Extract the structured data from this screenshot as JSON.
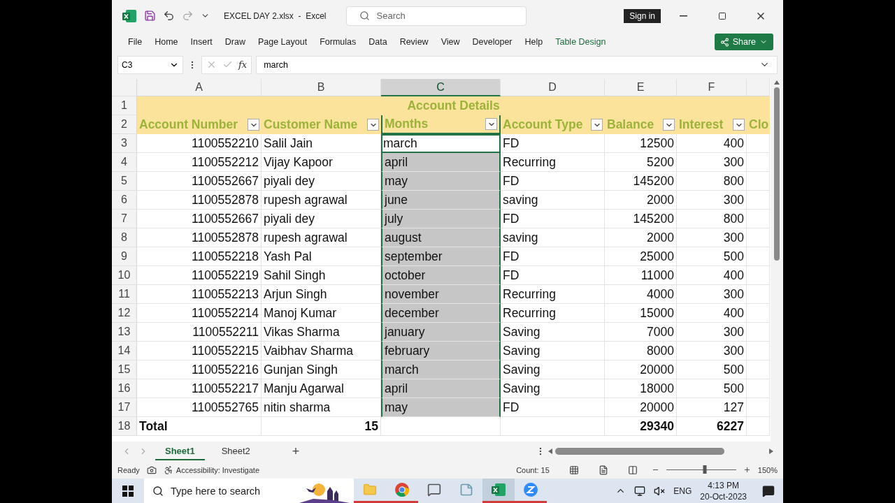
{
  "window": {
    "title": "EXCEL DAY 2.xlsx  -  Excel",
    "search_placeholder": "Search",
    "sign_in": "Sign in"
  },
  "ribbon_tabs": [
    {
      "label": "File",
      "kind": "normal"
    },
    {
      "label": "Home",
      "kind": "normal"
    },
    {
      "label": "Insert",
      "kind": "normal"
    },
    {
      "label": "Draw",
      "kind": "normal"
    },
    {
      "label": "Page Layout",
      "kind": "normal"
    },
    {
      "label": "Formulas",
      "kind": "normal"
    },
    {
      "label": "Data",
      "kind": "normal"
    },
    {
      "label": "Review",
      "kind": "normal"
    },
    {
      "label": "View",
      "kind": "normal"
    },
    {
      "label": "Developer",
      "kind": "normal"
    },
    {
      "label": "Help",
      "kind": "normal"
    },
    {
      "label": "Table Design",
      "kind": "contextual"
    }
  ],
  "share": "Share",
  "formula_bar": {
    "name_box": "C3",
    "fx": "fx",
    "value": "march"
  },
  "columns": [
    {
      "letter": "A",
      "selected": false
    },
    {
      "letter": "B",
      "selected": false
    },
    {
      "letter": "C",
      "selected": true
    },
    {
      "letter": "D",
      "selected": false
    },
    {
      "letter": "E",
      "selected": false
    },
    {
      "letter": "F",
      "selected": false
    }
  ],
  "title_row": {
    "number": "1",
    "text": "Account Details"
  },
  "header_row": {
    "number": "2",
    "cells": [
      "Account Number",
      "Customer Name",
      "Months",
      "Account Type",
      "Balance",
      "Interest",
      "Clo"
    ]
  },
  "rows": [
    {
      "number": "3",
      "active": true,
      "cells": [
        "1100552210",
        "Salil Jain",
        "march",
        "FD",
        "12500",
        "400"
      ]
    },
    {
      "number": "4",
      "active": false,
      "cells": [
        "1100552212",
        "Vijay Kapoor",
        "april",
        "Recurring",
        "5200",
        "300"
      ]
    },
    {
      "number": "5",
      "active": false,
      "cells": [
        "1100552667",
        "piyali dey",
        "may",
        "FD",
        "145200",
        "800"
      ]
    },
    {
      "number": "6",
      "active": false,
      "cells": [
        "1100552878",
        "rupesh agrawal",
        "june",
        "saving",
        "2000",
        "300"
      ]
    },
    {
      "number": "7",
      "active": false,
      "cells": [
        "1100552667",
        "piyali dey",
        "july",
        "FD",
        "145200",
        "800"
      ]
    },
    {
      "number": "8",
      "active": false,
      "cells": [
        "1100552878",
        "rupesh agrawal",
        "august",
        "saving",
        "2000",
        "300"
      ]
    },
    {
      "number": "9",
      "active": false,
      "cells": [
        "1100552218",
        "Yash Pal",
        "september",
        "FD",
        "25000",
        "500"
      ]
    },
    {
      "number": "10",
      "active": false,
      "cells": [
        "1100552219",
        "Sahil Singh",
        "october",
        "FD",
        "11000",
        "400"
      ]
    },
    {
      "number": "11",
      "active": false,
      "cells": [
        "1100552213",
        "Arjun Singh",
        "november",
        "Recurring",
        "4000",
        "300"
      ]
    },
    {
      "number": "12",
      "active": false,
      "cells": [
        "1100552214",
        "Manoj Kumar",
        "december",
        "Recurring",
        "15000",
        "400"
      ]
    },
    {
      "number": "13",
      "active": false,
      "cells": [
        "1100552211",
        "Vikas Sharma",
        "january",
        "Saving",
        "7000",
        "300"
      ]
    },
    {
      "number": "14",
      "active": false,
      "cells": [
        "1100552215",
        "Vaibhav Sharma",
        "february",
        "Saving",
        "8000",
        "300"
      ]
    },
    {
      "number": "15",
      "active": false,
      "cells": [
        "1100552216",
        "Gunjan Singh",
        "march",
        "Saving",
        "20000",
        "500"
      ]
    },
    {
      "number": "16",
      "active": false,
      "cells": [
        "1100552217",
        "Manju Agarwal",
        "april",
        "Saving",
        "18000",
        "500"
      ]
    },
    {
      "number": "17",
      "active": false,
      "cells": [
        "1100552765",
        "nitin sharma",
        "may",
        "FD",
        "20000",
        "127"
      ]
    }
  ],
  "total_row": {
    "number": "18",
    "label": "Total",
    "count": "15",
    "balance": "29340",
    "interest": "6227"
  },
  "sheet_tabs": [
    {
      "label": "Sheet1",
      "selected": true
    },
    {
      "label": "Sheet2",
      "selected": false
    }
  ],
  "add_sheet": "+",
  "status": {
    "ready": "Ready",
    "accessibility": "Accessibility: Investigate",
    "count": "Count: 15",
    "zoom": "150%",
    "zoom_slider": {
      "level": 0.55
    }
  },
  "taskbar": {
    "search_placeholder": "Type here to search",
    "language": "ENG",
    "time": "4:13 PM",
    "date": "20-Oct-2023",
    "apps": [
      {
        "kind": "explorer",
        "running": true,
        "active": false
      },
      {
        "kind": "chrome",
        "running": true,
        "active": false
      },
      {
        "kind": "feedback",
        "running": false,
        "active": false
      },
      {
        "kind": "notes",
        "running": false,
        "active": false
      },
      {
        "kind": "excel",
        "running": true,
        "active": true
      },
      {
        "kind": "zoom",
        "running": true,
        "active": false
      }
    ]
  }
}
